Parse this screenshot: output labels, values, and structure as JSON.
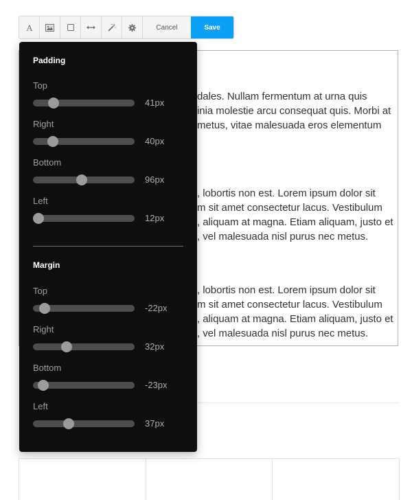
{
  "toolbar": {
    "tools": [
      {
        "name": "typography-icon",
        "label": "Text"
      },
      {
        "name": "image-icon",
        "label": "Image"
      },
      {
        "name": "border-icon",
        "label": "Border"
      },
      {
        "name": "spacing-icon",
        "label": "Spacing"
      },
      {
        "name": "magic-wand-icon",
        "label": "Effects"
      },
      {
        "name": "gear-icon",
        "label": "Settings"
      }
    ],
    "cancel_label": "Cancel",
    "save_label": "Save",
    "accent_color": "#0aa0f5"
  },
  "panel": {
    "padding": {
      "heading": "Padding",
      "fields": [
        {
          "label": "Top",
          "value": "41px",
          "fraction": 0.17
        },
        {
          "label": "Right",
          "value": "40px",
          "fraction": 0.16
        },
        {
          "label": "Bottom",
          "value": "96px",
          "fraction": 0.48
        },
        {
          "label": "Left",
          "value": "12px",
          "fraction": 0.0
        }
      ]
    },
    "margin": {
      "heading": "Margin",
      "fields": [
        {
          "label": "Top",
          "value": "-22px",
          "fraction": 0.07
        },
        {
          "label": "Right",
          "value": "32px",
          "fraction": 0.31
        },
        {
          "label": "Bottom",
          "value": "-23px",
          "fraction": 0.055
        },
        {
          "label": "Left",
          "value": "37px",
          "fraction": 0.33
        }
      ]
    }
  },
  "content": {
    "selection_color": "#6ee06e",
    "paragraphs": [
      [
        "dales. Nullam fermentum at urna quis",
        "inia molestie arcu consequat quis. Morbi at",
        "metus, vitae malesuada eros elementum"
      ],
      [
        ", lobortis non est. Lorem ipsum dolor sit",
        "m sit amet consectetur lacus. Vestibulum",
        ", aliquam at magna. Etiam aliquam, justo et",
        ", vel malesuada nisl purus nec metus."
      ],
      [
        ", lobortis non est. Lorem ipsum dolor sit",
        "m sit amet consectetur lacus. Vestibulum",
        ", aliquam at magna. Etiam aliquam, justo et",
        ", vel malesuada nisl purus nec metus."
      ]
    ]
  }
}
